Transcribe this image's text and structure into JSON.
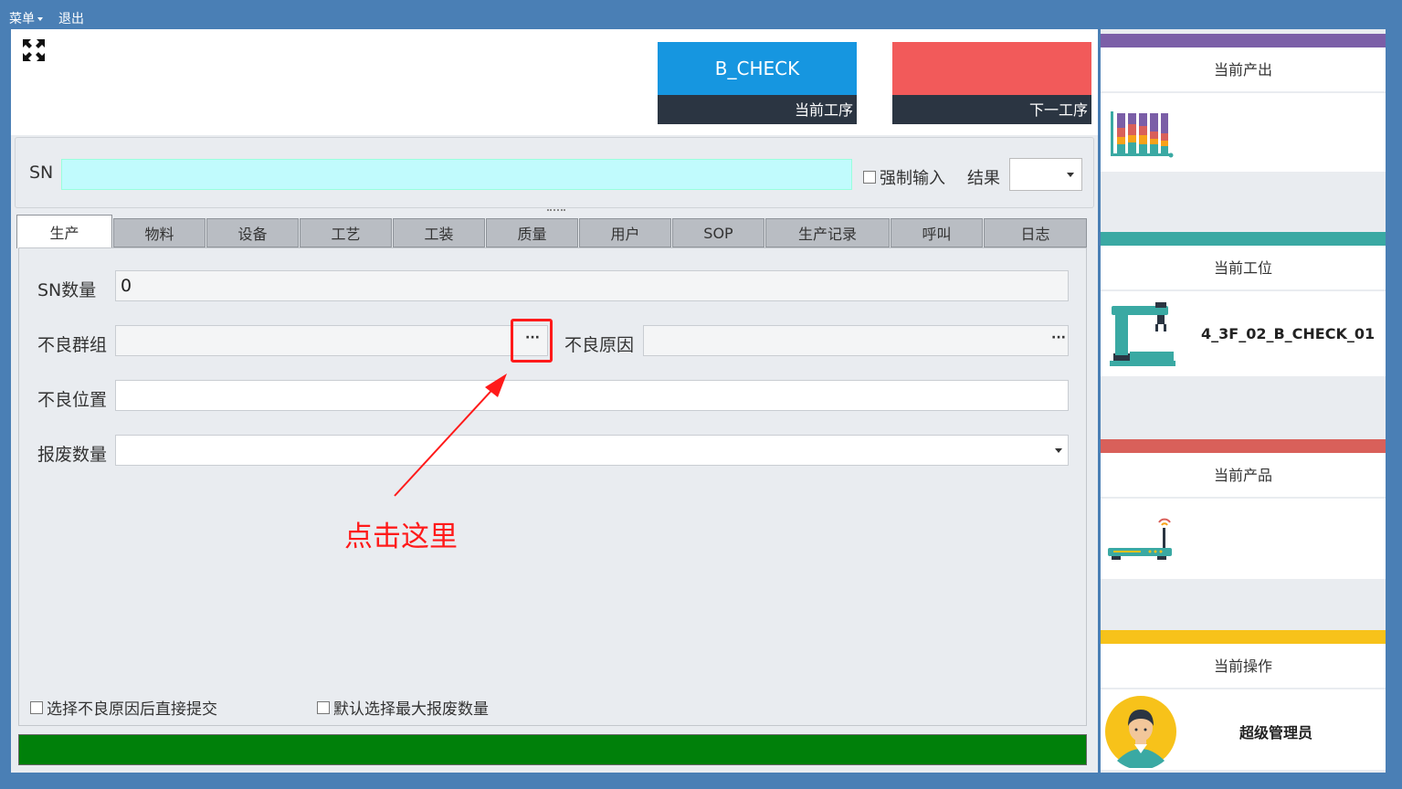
{
  "menubar": {
    "menu": "菜单",
    "exit": "退出"
  },
  "steps": {
    "current": {
      "name": "B_CHECK",
      "label": "当前工序",
      "color": "#1696e0"
    },
    "next": {
      "name": "",
      "label": "下一工序",
      "color": "#f25a5a"
    }
  },
  "sn": {
    "label": "SN",
    "value": "",
    "force_input": "强制输入",
    "result_label": "结果",
    "result_value": ""
  },
  "tabs": [
    "生产",
    "物料",
    "设备",
    "工艺",
    "工装",
    "质量",
    "用户",
    "SOP",
    "生产记录",
    "呼叫",
    "日志"
  ],
  "form": {
    "sn_count_label": "SN数量",
    "sn_count_value": "0",
    "defect_group_label": "不良群组",
    "defect_group_value": "",
    "defect_reason_label": "不良原因",
    "defect_reason_value": "",
    "defect_position_label": "不良位置",
    "defect_position_value": "",
    "scrap_qty_label": "报废数量",
    "scrap_qty_value": "",
    "ellipsis": "···"
  },
  "annotation": {
    "text": "点击这里",
    "color": "#ff1a1a"
  },
  "options": {
    "submit_after_reason": "选择不良原因后直接提交",
    "default_max_scrap": "默认选择最大报废数量"
  },
  "status_bar_color": "#00800a",
  "side": {
    "output": {
      "title": "当前产出",
      "color": "#7b5ea7"
    },
    "station": {
      "title": "当前工位",
      "value": "4_3F_02_B_CHECK_01",
      "color": "#3aa9a3"
    },
    "product": {
      "title": "当前产品",
      "value": "",
      "color": "#d9605a"
    },
    "operator": {
      "title": "当前操作",
      "value": "超级管理员",
      "color": "#f7c21a"
    }
  }
}
